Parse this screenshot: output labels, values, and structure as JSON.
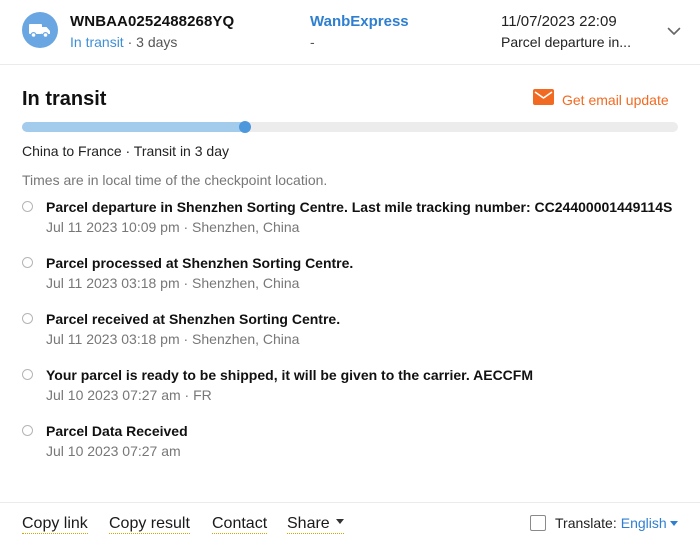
{
  "header": {
    "tracking_number": "WNBAA0252488268YQ",
    "status": "In transit",
    "separator": " · ",
    "duration": "3 days",
    "carrier": "WanbExpress",
    "carrier_sub": "-",
    "last_time": "11/07/2023 22:09",
    "last_event": "Parcel departure in...",
    "icons": {
      "carrier": "truck-icon",
      "expand": "chevron-down-icon"
    }
  },
  "main": {
    "title": "In transit",
    "email_update_label": "Get email update",
    "progress": 0.34,
    "route": "China to France · Transit in 3 day",
    "timezone_note": "Times are in local time of the checkpoint location.",
    "events": [
      {
        "title": "Parcel departure in Shenzhen Sorting Centre. Last mile tracking number: CC24400001449114S",
        "meta": "Jul 11 2023 10:09 pm · Shenzhen, China"
      },
      {
        "title": "Parcel processed at Shenzhen Sorting Centre.",
        "meta": "Jul 11 2023 03:18 pm · Shenzhen, China"
      },
      {
        "title": "Parcel received at Shenzhen Sorting Centre.",
        "meta": "Jul 11 2023 03:18 pm · Shenzhen, China"
      },
      {
        "title": "Your parcel is ready to be shipped, it will be given to the carrier. AECCFM",
        "meta": "Jul 10 2023 07:27 am · FR"
      },
      {
        "title": "Parcel Data Received",
        "meta": "Jul 10 2023 07:27 am"
      }
    ]
  },
  "footer": {
    "copy_link": "Copy link",
    "copy_result": "Copy result",
    "contact": "Contact",
    "share": "Share",
    "translate_label": "Translate:",
    "language": "English"
  },
  "colors": {
    "accent_blue": "#2f7fd1",
    "status_blue": "#3f8fd6",
    "email_orange": "#f26a21",
    "progress_fill": "#a3cbec",
    "progress_dot": "#4b98dd"
  }
}
